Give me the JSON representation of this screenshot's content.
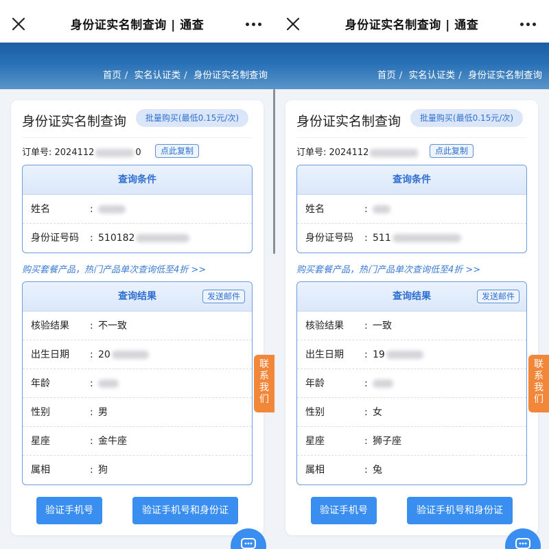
{
  "panels": [
    {
      "nav": {
        "title": "身份证实名制查询 | 通查"
      },
      "breadcrumb": [
        "首页",
        "实名认证类",
        "身份证实名制查询"
      ],
      "card": {
        "title": "身份证实名制查询",
        "bulk_label": "批量购买(最低0.15元/次)",
        "order_prefix": "订单号: 2024112",
        "order_suffix": "0",
        "copy_label": "点此复制",
        "query": {
          "header": "查询条件",
          "rows": [
            {
              "label": "姓名",
              "value": ""
            },
            {
              "label": "身份证号码",
              "value": "510182"
            }
          ]
        },
        "promo": "购买套餐产品，热门产品单次查询低至4折 >>",
        "result": {
          "header": "查询结果",
          "mail_label": "发送邮件",
          "rows": [
            {
              "label": "核验结果",
              "value": "不一致"
            },
            {
              "label": "出生日期",
              "value": "20"
            },
            {
              "label": "年龄",
              "value": ""
            },
            {
              "label": "性别",
              "value": "男"
            },
            {
              "label": "星座",
              "value": "金牛座"
            },
            {
              "label": "属相",
              "value": "狗"
            }
          ]
        },
        "btn_phone": "验证手机号",
        "btn_phone_id": "验证手机号和身份证"
      },
      "contact": [
        "联",
        "系",
        "我",
        "们"
      ]
    },
    {
      "nav": {
        "title": "身份证实名制查询 | 通查"
      },
      "breadcrumb": [
        "首页",
        "实名认证类",
        "身份证实名制查询"
      ],
      "card": {
        "title": "身份证实名制查询",
        "bulk_label": "批量购买(最低0.15元/次)",
        "order_prefix": "订单号: 2024112",
        "order_suffix": "",
        "copy_label": "点此复制",
        "query": {
          "header": "查询条件",
          "rows": [
            {
              "label": "姓名",
              "value": ""
            },
            {
              "label": "身份证号码",
              "value": "511"
            }
          ]
        },
        "promo": "购买套餐产品，热门产品单次查询低至4折 >>",
        "result": {
          "header": "查询结果",
          "mail_label": "发送邮件",
          "rows": [
            {
              "label": "核验结果",
              "value": "一致"
            },
            {
              "label": "出生日期",
              "value": "19"
            },
            {
              "label": "年龄",
              "value": ""
            },
            {
              "label": "性别",
              "value": "女"
            },
            {
              "label": "星座",
              "value": "狮子座"
            },
            {
              "label": "属相",
              "value": "兔"
            }
          ]
        },
        "btn_phone": "验证手机号",
        "btn_phone_id": "验证手机号和身份证"
      },
      "contact": [
        "联",
        "系",
        "我",
        "们"
      ]
    }
  ],
  "colors": {
    "accent": "#3a8ef0",
    "banner": "#1a5ea3",
    "contact": "#f2873a"
  }
}
